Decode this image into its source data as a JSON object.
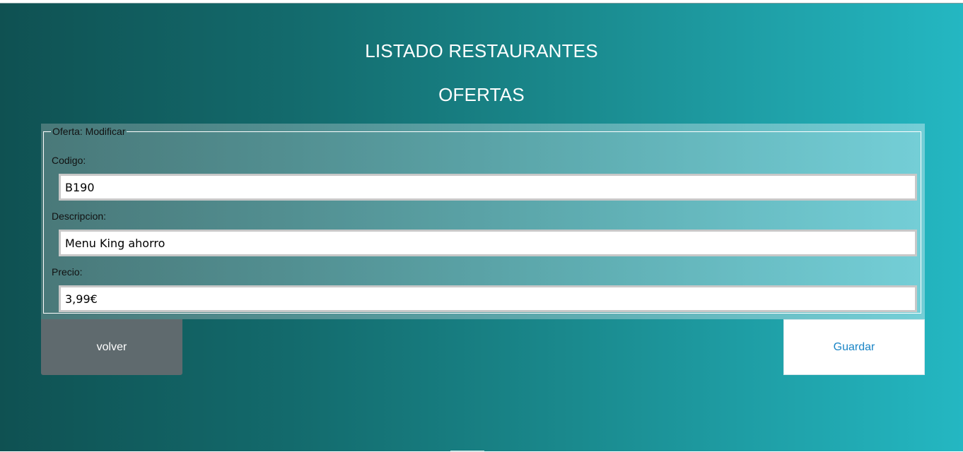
{
  "header": {
    "title": "LISTADO RESTAURANTES",
    "subtitle": "OFERTAS"
  },
  "form": {
    "legend": "Oferta: Modificar",
    "fields": [
      {
        "label": "Codigo:",
        "value": "B190"
      },
      {
        "label": "Descripcion:",
        "value": "Menu King ahorro"
      },
      {
        "label": "Precio:",
        "value": "3,99€"
      }
    ]
  },
  "actions": {
    "back_label": "volver",
    "save_label": "Guardar"
  },
  "colors": {
    "background_start": "#0f5152",
    "background_end": "#24b7c2",
    "back_button": "#5f6a6e",
    "save_text": "#1a85c6"
  }
}
